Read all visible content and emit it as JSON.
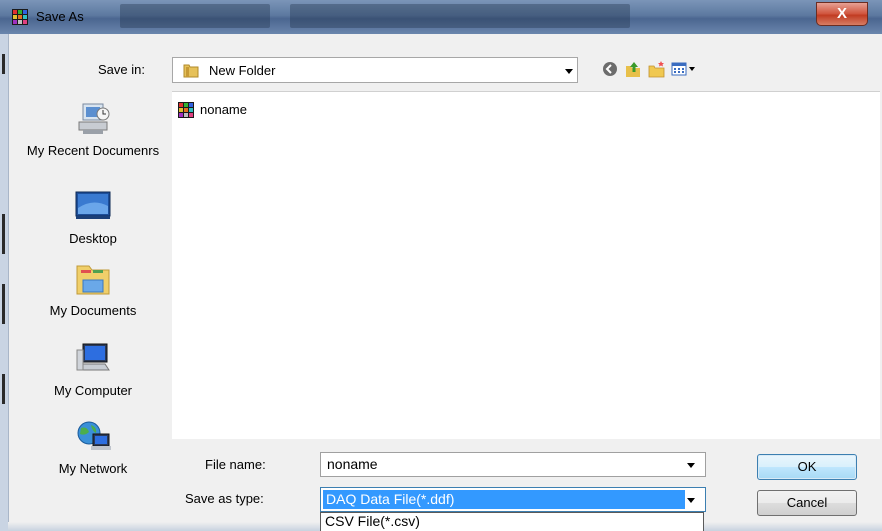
{
  "window": {
    "title": "Save As",
    "close_glyph": "X"
  },
  "save_in": {
    "label": "Save in:",
    "value": "New Folder"
  },
  "toolbar": {
    "icons": [
      "back-icon",
      "up-folder-icon",
      "new-folder-icon",
      "view-menu-icon"
    ]
  },
  "places": [
    {
      "label": "My Recent Documenrs",
      "icon": "recent-documents-icon"
    },
    {
      "label": "Desktop",
      "icon": "desktop-icon"
    },
    {
      "label": "My Documents",
      "icon": "my-documents-icon"
    },
    {
      "label": "My Computer",
      "icon": "my-computer-icon"
    },
    {
      "label": "My Network",
      "icon": "my-network-icon"
    }
  ],
  "files": [
    {
      "name": "noname",
      "icon": "ddf-file-icon"
    }
  ],
  "file_name": {
    "label": "File name:",
    "value": "noname"
  },
  "save_as_type": {
    "label": "Save as type:",
    "value": "DAQ Data File(*.ddf)",
    "options": [
      "CSV File(*.csv)"
    ]
  },
  "buttons": {
    "ok": "OK",
    "cancel": "Cancel"
  },
  "colors": {
    "selection": "#3399ff",
    "default_button_border": "#3c7fb1",
    "close_button": "#c13b22"
  }
}
